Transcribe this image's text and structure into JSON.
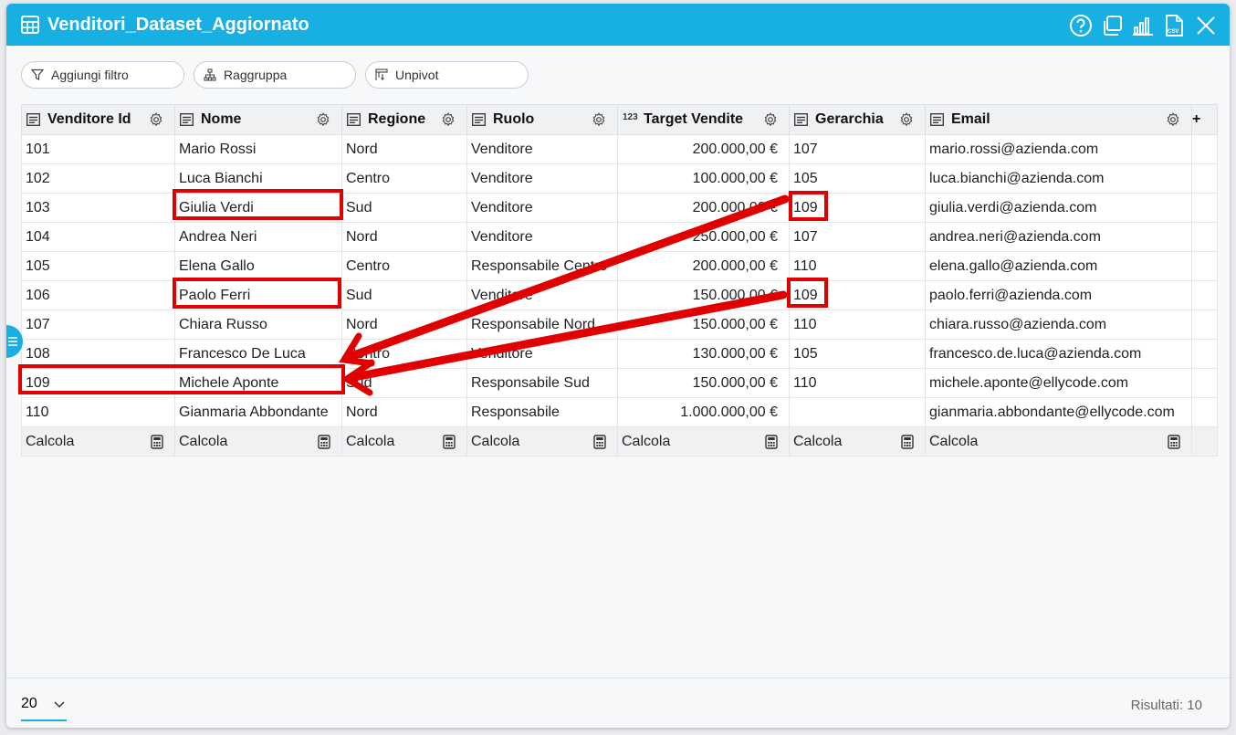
{
  "window": {
    "title": "Venditori_Dataset_Aggiornato"
  },
  "titlebar_icons": [
    "help-icon",
    "copy-icon",
    "bar-chart-icon",
    "csv-export-icon",
    "close-icon"
  ],
  "toolbar": {
    "filter_label": "Aggiungi filtro",
    "group_label": "Raggruppa",
    "unpivot_label": "Unpivot"
  },
  "table": {
    "columns": [
      {
        "label": "Venditore Id",
        "type": "text-icon"
      },
      {
        "label": "Nome",
        "type": "text-icon"
      },
      {
        "label": "Regione",
        "type": "text-icon"
      },
      {
        "label": "Ruolo",
        "type": "text-icon"
      },
      {
        "label": "Target Vendite",
        "type": "number-icon",
        "type_text": "123"
      },
      {
        "label": "Gerarchia",
        "type": "text-icon"
      },
      {
        "label": "Email",
        "type": "text-icon"
      }
    ],
    "add_column_label": "+",
    "rows": [
      [
        "101",
        "Mario Rossi",
        "Nord",
        "Venditore",
        "200.000,00 €",
        "107",
        "mario.rossi@azienda.com"
      ],
      [
        "102",
        "Luca Bianchi",
        "Centro",
        "Venditore",
        "100.000,00 €",
        "105",
        "luca.bianchi@azienda.com"
      ],
      [
        "103",
        "Giulia Verdi",
        "Sud",
        "Venditore",
        "200.000,00 €",
        "109",
        "giulia.verdi@azienda.com"
      ],
      [
        "104",
        "Andrea Neri",
        "Nord",
        "Venditore",
        "250.000,00 €",
        "107",
        "andrea.neri@azienda.com"
      ],
      [
        "105",
        "Elena Gallo",
        "Centro",
        "Responsabile Centro",
        "200.000,00 €",
        "110",
        "elena.gallo@azienda.com"
      ],
      [
        "106",
        "Paolo Ferri",
        "Sud",
        "Venditore",
        "150.000,00 €",
        "109",
        "paolo.ferri@azienda.com"
      ],
      [
        "107",
        "Chiara Russo",
        "Nord",
        "Responsabile Nord",
        "150.000,00 €",
        "110",
        "chiara.russo@azienda.com"
      ],
      [
        "108",
        "Francesco De Luca",
        "Centro",
        "Venditore",
        "130.000,00 €",
        "105",
        "francesco.de.luca@azienda.com"
      ],
      [
        "109",
        "Michele Aponte",
        "Sud",
        "Responsabile Sud",
        "150.000,00 €",
        "110",
        "michele.aponte@ellycode.com"
      ],
      [
        "110",
        "Gianmaria Abbondante",
        "Nord",
        "Responsabile",
        "1.000.000,00 €",
        "",
        "gianmaria.abbondante@ellycode.com"
      ]
    ],
    "footer_label": "Calcola"
  },
  "pager": {
    "page_size": "20"
  },
  "results": {
    "label": "Risultati: 10"
  },
  "colors": {
    "accent": "#18b0e3",
    "annotation": "#e00000"
  }
}
